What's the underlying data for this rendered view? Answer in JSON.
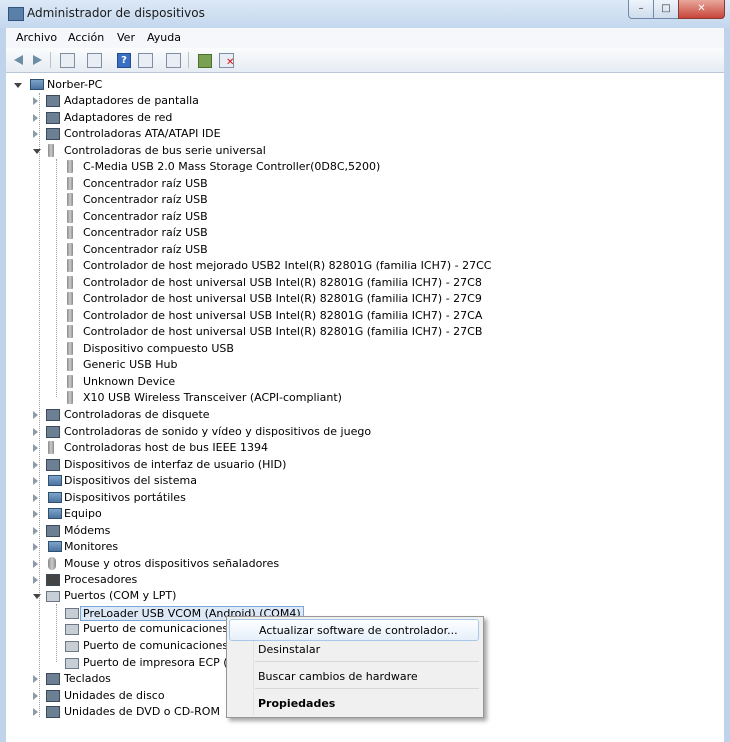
{
  "window": {
    "title": "Administrador de dispositivos",
    "controls": {
      "min": "–",
      "max": "□",
      "close": "✕"
    }
  },
  "menu": [
    "Archivo",
    "Acción",
    "Ver",
    "Ayuda"
  ],
  "tree": {
    "root": "Norber-PC",
    "items": [
      {
        "label": "Adaptadores de pantalla"
      },
      {
        "label": "Adaptadores de red"
      },
      {
        "label": "Controladoras ATA/ATAPI IDE"
      },
      {
        "label": "Controladoras de bus serie universal",
        "expanded": true,
        "children": [
          "C-Media USB 2.0 Mass Storage Controller(0D8C,5200)",
          "Concentrador raíz USB",
          "Concentrador raíz USB",
          "Concentrador raíz USB",
          "Concentrador raíz USB",
          "Concentrador raíz USB",
          "Controlador de host mejorado USB2 Intel(R) 82801G (familia ICH7) - 27CC",
          "Controlador de host universal USB Intel(R) 82801G (familia ICH7) - 27C8",
          "Controlador de host universal USB Intel(R) 82801G (familia ICH7) - 27C9",
          "Controlador de host universal USB Intel(R) 82801G (familia ICH7) - 27CA",
          "Controlador de host universal USB Intel(R) 82801G (familia ICH7) - 27CB",
          "Dispositivo compuesto USB",
          "Generic USB Hub",
          "Unknown Device",
          "X10 USB Wireless Transceiver (ACPI-compliant)"
        ]
      },
      {
        "label": "Controladoras de disquete"
      },
      {
        "label": "Controladoras de sonido y vídeo y dispositivos de juego"
      },
      {
        "label": "Controladoras host de bus IEEE 1394"
      },
      {
        "label": "Dispositivos de interfaz de usuario (HID)"
      },
      {
        "label": "Dispositivos del sistema"
      },
      {
        "label": "Dispositivos portátiles"
      },
      {
        "label": "Equipo"
      },
      {
        "label": "Módems"
      },
      {
        "label": "Monitores"
      },
      {
        "label": "Mouse y otros dispositivos señaladores"
      },
      {
        "label": "Procesadores"
      },
      {
        "label": "Puertos (COM y LPT)",
        "expanded": true,
        "children": [
          "PreLoader USB VCOM (Android) (COM4)",
          "Puerto de comunicaciones (C",
          "Puerto de comunicaciones (C",
          "Puerto de impresora ECP (LPT"
        ]
      },
      {
        "label": "Teclados"
      },
      {
        "label": "Unidades de disco"
      },
      {
        "label": "Unidades de DVD o CD-ROM"
      }
    ]
  },
  "context_menu": {
    "items": [
      "Actualizar software de controlador...",
      "Desinstalar",
      "Buscar cambios de hardware",
      "Propiedades"
    ]
  }
}
